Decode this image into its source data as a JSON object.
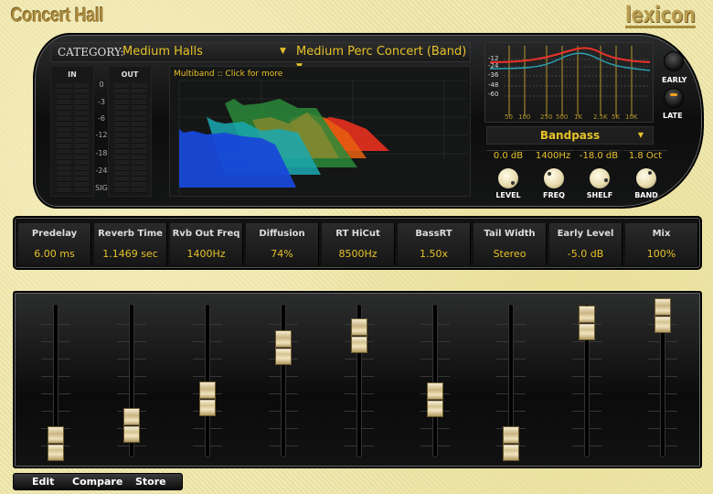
{
  "title": "Concert Hall",
  "logo": "lexicon",
  "category": {
    "label": "CATEGORY:",
    "value": "Medium Halls",
    "preset": "Medium Perc Concert (Band)"
  },
  "meters": {
    "in_label": "IN",
    "out_label": "OUT",
    "scale": [
      "0",
      "-3",
      "-6",
      "-12",
      "-18",
      "-24",
      "SIG"
    ]
  },
  "multiband": {
    "label": "Multiband :: Click for more"
  },
  "eq": {
    "db_labels": [
      "-12",
      "-24",
      "-36",
      "-48",
      "-60"
    ],
    "freq_labels": [
      "50",
      "100",
      "250",
      "500",
      "1K",
      "2.5K",
      "5K",
      "10K"
    ],
    "curve_colors": [
      "#e8322a",
      "#2a9fb0"
    ],
    "band_type": "Bandpass",
    "values": [
      "0.0 dB",
      "1400Hz",
      "-18.0 dB",
      "1.8 Oct"
    ],
    "knob_labels": [
      "LEVEL",
      "FREQ",
      "SHELF",
      "BAND"
    ]
  },
  "early_late": {
    "early": "EARLY",
    "late": "LATE",
    "selected": "LATE"
  },
  "params": [
    {
      "name": "Predelay",
      "value": "6.00 ms",
      "fader": 0.06
    },
    {
      "name": "Reverb Time",
      "value": "1.1469 sec",
      "fader": 0.19
    },
    {
      "name": "Rvb Out Freq",
      "value": "1400Hz",
      "fader": 0.37
    },
    {
      "name": "Diffusion",
      "value": "74%",
      "fader": 0.72
    },
    {
      "name": "RT HiCut",
      "value": "8500Hz",
      "fader": 0.8
    },
    {
      "name": "BassRT",
      "value": "1.50x",
      "fader": 0.36
    },
    {
      "name": "Tail Width",
      "value": "Stereo",
      "fader": 0.06
    },
    {
      "name": "Early Level",
      "value": "-5.0 dB",
      "fader": 0.89
    },
    {
      "name": "Mix",
      "value": "100%",
      "fader": 0.94
    }
  ],
  "bottom": {
    "edit": "Edit",
    "compare": "Compare",
    "store": "Store"
  },
  "colors": {
    "accent": "#e6c22a",
    "background": "#efe7a9"
  }
}
